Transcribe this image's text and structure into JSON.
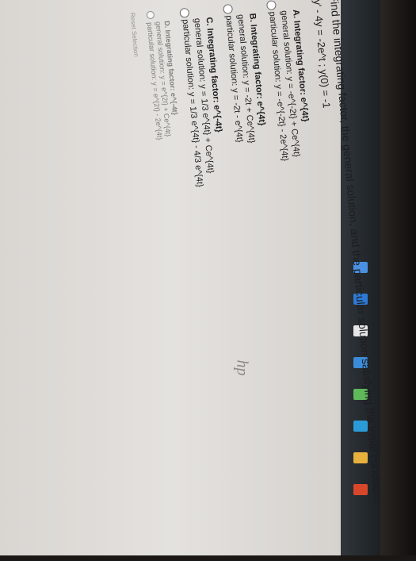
{
  "question": {
    "prompt": "Find the integrating factor, the general solution, and the particular solution satisfying the initial condition.",
    "equation": "y' - 4y = -2e^t ; y(0) = -1"
  },
  "options": [
    {
      "label": "A. Integrating factor: e^{4t}",
      "general": "general solution: y = -e^{-2t} + Ce^{4t}",
      "particular": "particular solution: y = -e^{-2t} - 2e^{4t}"
    },
    {
      "label": "B. Integrating factor: e^{4t}",
      "general": "general solution: y = -2t + Ce^{4t}",
      "particular": "particular solution: y = -2t - e^{4t}"
    },
    {
      "label": "C. Integrating factor: e^{-4t}",
      "general": "general solution: y = 1/3 e^{4t} + Ce^{4t}",
      "particular": "particular solution: y = 1/3 e^{4t} - 4/3 e^{4t}"
    },
    {
      "label": "D. Integrating factor: e^{-4t}",
      "general": "general solution: y = e^{2t} + Ce^{4t}",
      "particular": "particular solution: y = e^{2t} - 2e^{4t}"
    }
  ],
  "reset_label": "Reset Selection",
  "taskbar_colors": [
    "#4a90e2",
    "#2d7ad6",
    "#e6e6e6",
    "#3c8bd9",
    "#5fb85a",
    "#2a9bd6",
    "#e6b13c",
    "#d9472b"
  ]
}
